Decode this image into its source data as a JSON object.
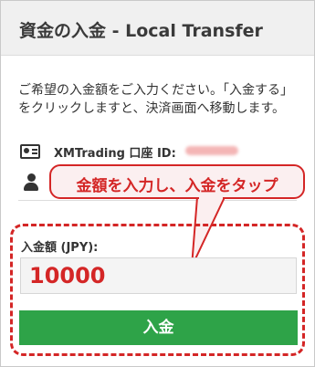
{
  "header": {
    "title": "資金の入金 - Local Transfer"
  },
  "instructions": {
    "text": "ご希望の入金額をご入力ください。「入金する」をクリックしますと、決済画面へ移動します。"
  },
  "account": {
    "label": "XMTrading 口座 ID:"
  },
  "callout": {
    "text": "金額を入力し、入金をタップ"
  },
  "form": {
    "amount_label": "入金額 (JPY):",
    "amount_value": "10000",
    "submit_label": "入金"
  },
  "colors": {
    "accent_red": "#d42626",
    "button_green": "#2ea348",
    "header_bg": "#f0f0f0"
  },
  "icons": [
    "id-card-icon",
    "user-icon"
  ]
}
